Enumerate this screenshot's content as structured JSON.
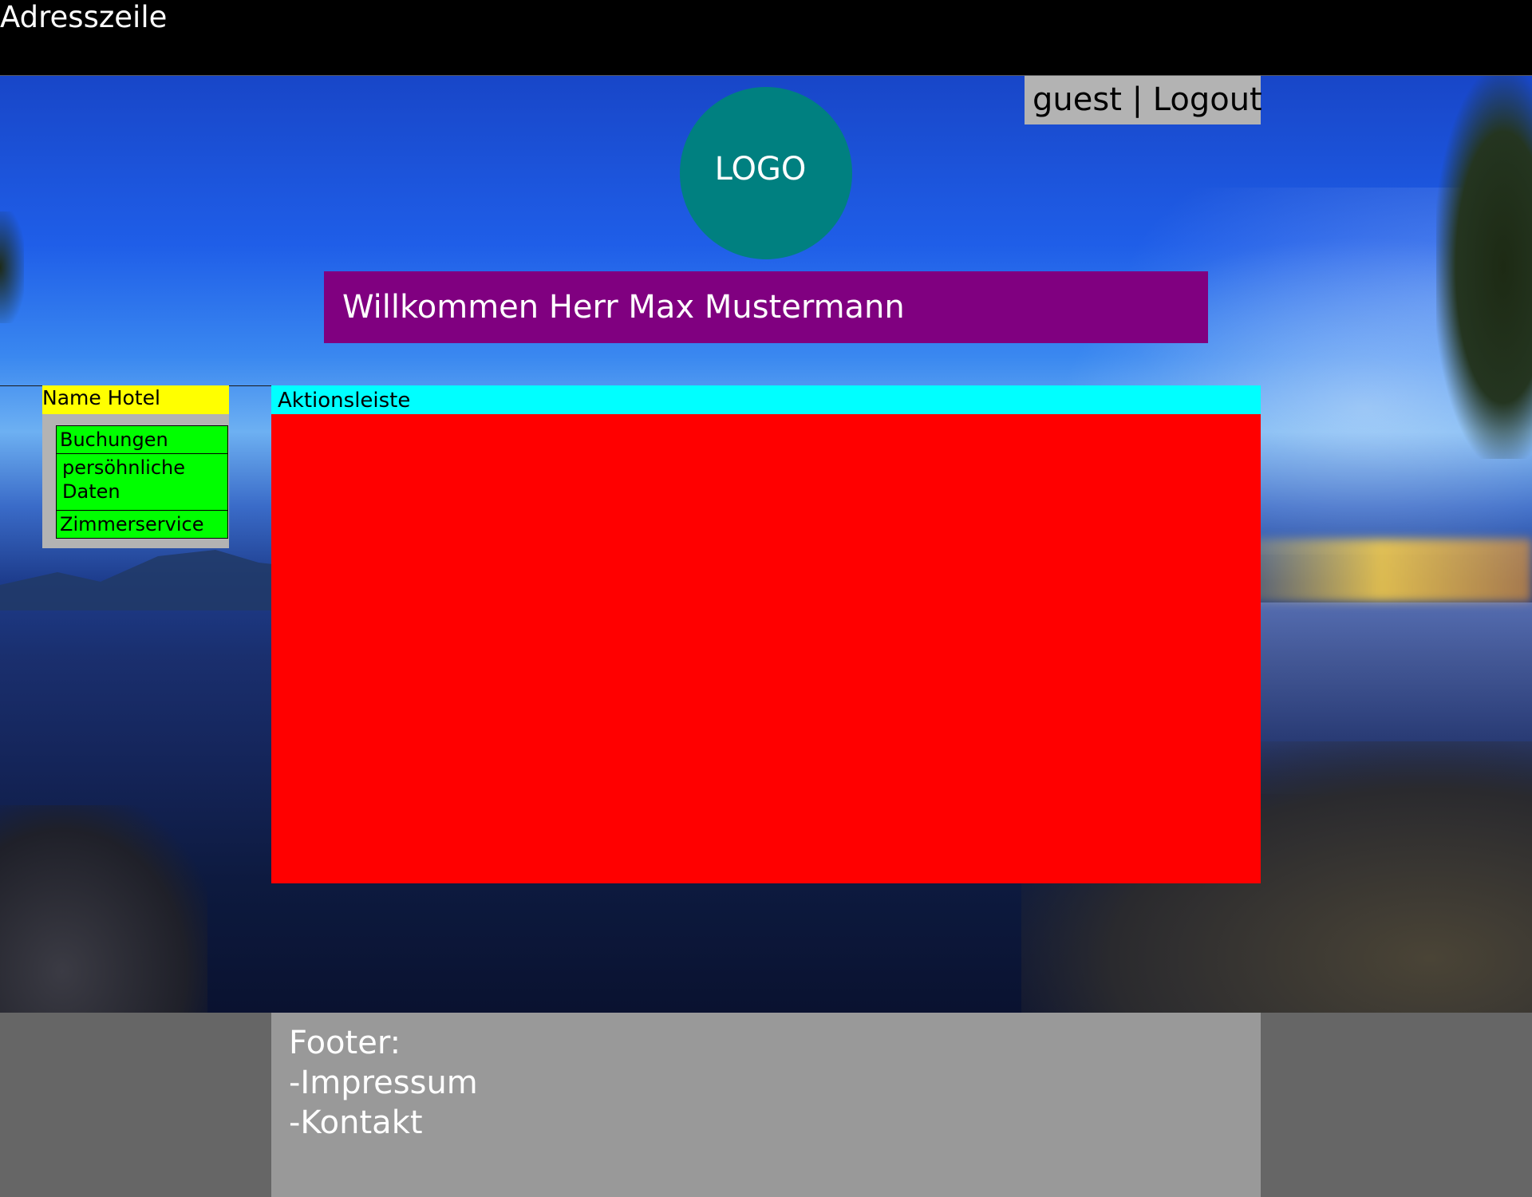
{
  "address_bar": {
    "label": "Adresszeile"
  },
  "user_box": {
    "text": "guest | Logout"
  },
  "logo": {
    "text": "LOGO"
  },
  "welcome": {
    "text": "Willkommen Herr Max Mustermann"
  },
  "sidebar": {
    "hotel_name": "Name Hotel",
    "items": [
      {
        "label": "Buchungen"
      },
      {
        "label": "persöhnliche Daten"
      },
      {
        "label": "Zimmerservice"
      }
    ]
  },
  "main": {
    "action_bar": "Aktionsleiste"
  },
  "footer": {
    "title": "Footer:",
    "links": [
      {
        "label": "-Impressum"
      },
      {
        "label": "-Kontakt"
      }
    ]
  },
  "colors": {
    "address_bar": "#000000",
    "user_box": "#b3b3b3",
    "logo": "#008080",
    "welcome": "#800080",
    "hotel_name": "#ffff00",
    "menu_item": "#00ff00",
    "action_bar": "#00ffff",
    "content": "#ff0000",
    "footer_outer": "#666666",
    "footer_panel": "#999999"
  }
}
